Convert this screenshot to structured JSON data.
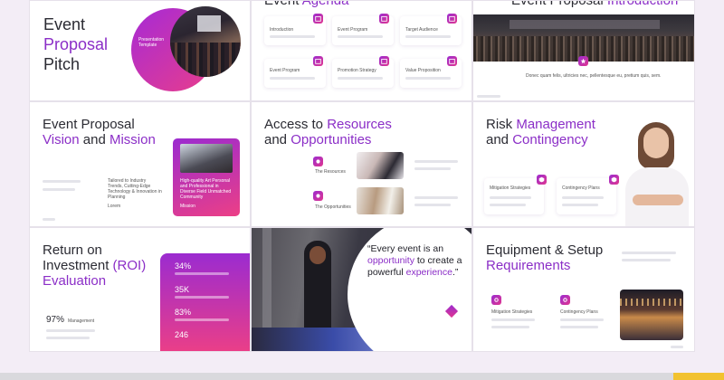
{
  "colors": {
    "accent": "#8b2ec7",
    "pink": "#e0368f",
    "gradient_start": "#9b2bd0",
    "gradient_end": "#ec3f86"
  },
  "slide1": {
    "title_1": "Event",
    "title_2": "Proposal",
    "title_3": "Pitch",
    "circle_text": "Presentation Template"
  },
  "slide2": {
    "title_plain": "Event ",
    "title_accent": "Agenda",
    "items": [
      "Introduction",
      "Event Program",
      "Target Audience",
      "Event Program",
      "Promotion Strategy",
      "Value Proposition"
    ]
  },
  "slide3": {
    "title_plain": "Event Proposal ",
    "title_accent": "Introduction",
    "body": "Donec quam felis, ultricies nec, pellentesque eu, pretium quis, sem."
  },
  "slide4": {
    "title_1": "Event Proposal",
    "title_2_accent": "Vision",
    "title_2_and": " and ",
    "title_2_accent_b": "Mission",
    "left_text": "Tailored to Industry Trends, Cutting-Edge Technology & Innovation in Planning",
    "left_small": "Lorem",
    "card_text": "High-quality Art Personal and Professional in Diverse Field Unmatched Community",
    "card_small": "Mission"
  },
  "slide5": {
    "title_1a": "Access to ",
    "title_1b": "Resources",
    "title_2a": "and ",
    "title_2b": "Opportunities",
    "label_1": "The Resources",
    "label_2": "The Opportunities"
  },
  "slide6": {
    "title_1a": "Risk ",
    "title_1b": "Management",
    "title_2a": "and ",
    "title_2b": "Contingency",
    "label_1": "Mitigation Strategies",
    "label_2": "Contingency Plans"
  },
  "slide7": {
    "title_1": "Return on",
    "title_2a": "Investment ",
    "title_2b": "(ROI)",
    "title_3": "Evaluation",
    "big_stat": "97%",
    "big_stat_label": "Management",
    "stats": [
      "34%",
      "35K",
      "83%",
      "246"
    ]
  },
  "slide8": {
    "quote_1": "“Every event is an",
    "quote_2a": "opportunity",
    "quote_2b": " to create a",
    "quote_3a": "powerful ",
    "quote_3b": "experience",
    "quote_3c": ".”"
  },
  "slide9": {
    "title_1": "Equipment & Setup",
    "title_2": "Requirements",
    "label_1": "Mitigation Strategies",
    "label_2": "Contingency Plans"
  }
}
